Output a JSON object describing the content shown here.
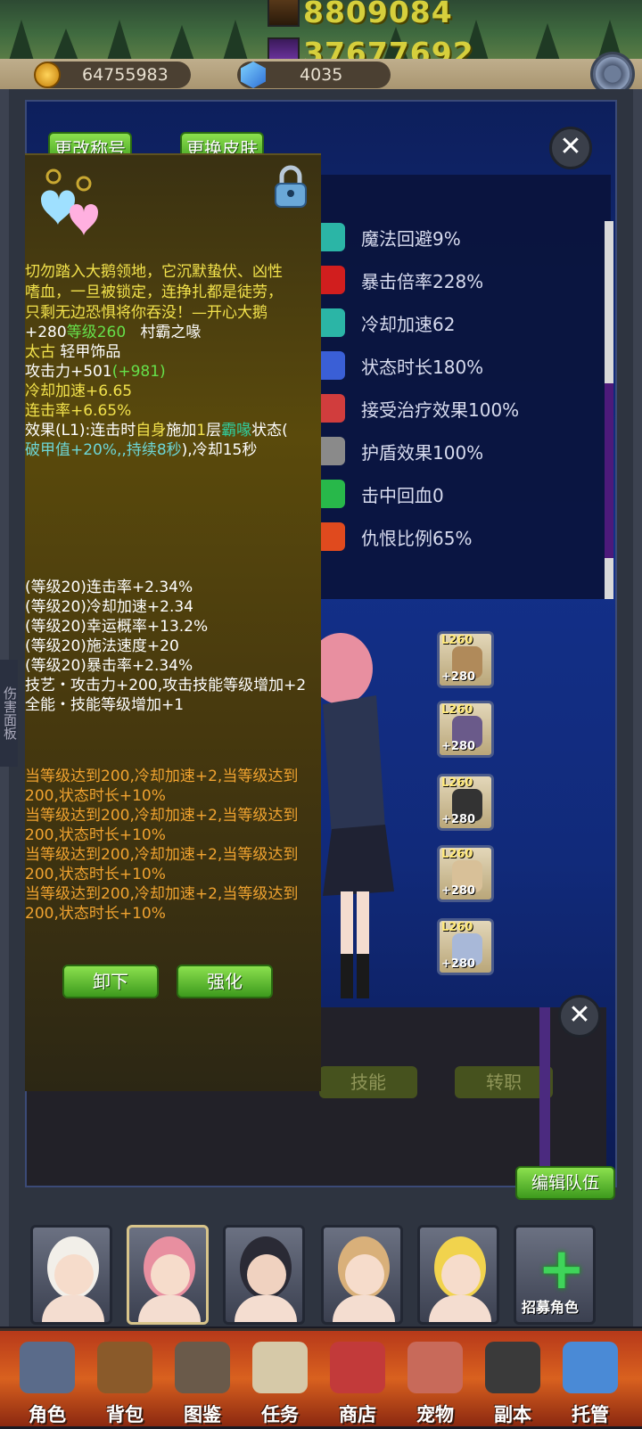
{
  "top_banner": {
    "score_1": "8809084",
    "score_2": "37677692"
  },
  "resources": {
    "coins": "64755983",
    "gems": "4035",
    "settings_icon": "gear-icon"
  },
  "header_buttons": {
    "change_title": "更改称号",
    "change_skin": "更换皮肤"
  },
  "stats": [
    {
      "label": "魔法回避9%",
      "icon": "magic-evasion-icon",
      "color": "#2bb5a6"
    },
    {
      "label": "暴击倍率228%",
      "icon": "crit-multiplier-icon",
      "color": "#d11e1e"
    },
    {
      "label": "冷却加速62",
      "icon": "cooldown-hourglass-icon",
      "color": "#2bb5a6"
    },
    {
      "label": "状态时长180%",
      "icon": "status-duration-icon",
      "color": "#3a5fd6"
    },
    {
      "label": "接受治疗效果100%",
      "icon": "heal-received-icon",
      "color": "#d13d3d"
    },
    {
      "label": "护盾效果100%",
      "icon": "shield-effect-icon",
      "color": "#8a8a8a"
    },
    {
      "label": "击中回血0",
      "icon": "lifesteal-drop-icon",
      "color": "#28b84a"
    },
    {
      "label": "仇恨比例65%",
      "icon": "aggro-devil-icon",
      "color": "#e04a1e"
    }
  ],
  "equipment": [
    {
      "level": "L260",
      "plus": "+280",
      "icon": "necklace-icon"
    },
    {
      "level": "L260",
      "plus": "+280",
      "icon": "armor-icon"
    },
    {
      "level": "L260",
      "plus": "+280",
      "icon": "sword-icon"
    },
    {
      "level": "L260",
      "plus": "+280",
      "icon": "gloves-icon"
    },
    {
      "level": "L260",
      "plus": "+280",
      "icon": "boots-icon"
    }
  ],
  "side_tab": "伤害面板",
  "tooltip": {
    "desc_1": "切勿踏入大鹅领地，它沉默蛰伏、凶性",
    "desc_2": "嗜血，一旦被锁定，连挣扎都是徒劳，",
    "desc_3": "只剩无边恐惧将你吞没！—开心大鹅",
    "enhance": "+280",
    "level": "等级260",
    "item_name": "村霸之喙",
    "rarity": "太古",
    "item_type": "轻甲饰品",
    "atk": "攻击力+501",
    "atk_bonus": "(+981)",
    "cdr": "冷却加速+6.65",
    "combo": "连击率+6.65%",
    "effect_prefix": "效果(L1):连击时",
    "effect_self": "自身",
    "effect_apply": "施加",
    "effect_num": "1",
    "effect_layer": "层",
    "effect_status": "霸喙",
    "effect_state": "状态(",
    "effect_line2": "破甲值+20%,,持续8秒",
    "effect_line2_tail": "),冷却15秒",
    "subs": [
      "(等级20)连击率+2.34%",
      "(等级20)冷却加速+2.34",
      "(等级20)幸运概率+13.2%",
      "(等级20)施法速度+20",
      "(等级20)暴击率+2.34%"
    ],
    "skill_1": "技艺・攻击力+200,攻击技能等级增加+2",
    "skill_2": "全能・技能等级增加+1",
    "set_bonus": [
      "当等级达到200,冷却加速+2,当等级达到",
      "200,状态时长+10%",
      "当等级达到200,冷却加速+2,当等级达到",
      "200,状态时长+10%",
      "当等级达到200,冷却加速+2,当等级达到",
      "200,状态时长+10%",
      "当等级达到200,冷却加速+2,当等级达到",
      "200,状态时长+10%"
    ],
    "btn_unequip": "卸下",
    "btn_enhance": "强化"
  },
  "lower_panel": {
    "skills_btn": "技能",
    "transfer_btn": "转职",
    "edit_team": "编辑队伍"
  },
  "roster": {
    "recruit": "招募角色",
    "portraits": [
      {
        "hair": "#f2efe9",
        "skin": "#f6dccb"
      },
      {
        "hair": "#e88fa0",
        "skin": "#f6dccb"
      },
      {
        "hair": "#2a2a35",
        "skin": "#f0d2c0"
      },
      {
        "hair": "#d9b07a",
        "skin": "#f6dccb"
      },
      {
        "hair": "#f1d34d",
        "skin": "#f6dccb"
      }
    ]
  },
  "nav": [
    {
      "label": "角色",
      "icon": "helmet-icon",
      "color": "#5a6b8a"
    },
    {
      "label": "背包",
      "icon": "backpack-icon",
      "color": "#8a5a2a"
    },
    {
      "label": "图鉴",
      "icon": "book-icon",
      "color": "#6a5a4a"
    },
    {
      "label": "任务",
      "icon": "scroll-icon",
      "color": "#d6c9a8"
    },
    {
      "label": "商店",
      "icon": "shop-icon",
      "color": "#c23a3a"
    },
    {
      "label": "宠物",
      "icon": "meat-icon",
      "color": "#c86a5a"
    },
    {
      "label": "副本",
      "icon": "skull-icon",
      "color": "#3a3a3a"
    },
    {
      "label": "托管",
      "icon": "calendar-icon",
      "color": "#4a8ad6"
    }
  ]
}
